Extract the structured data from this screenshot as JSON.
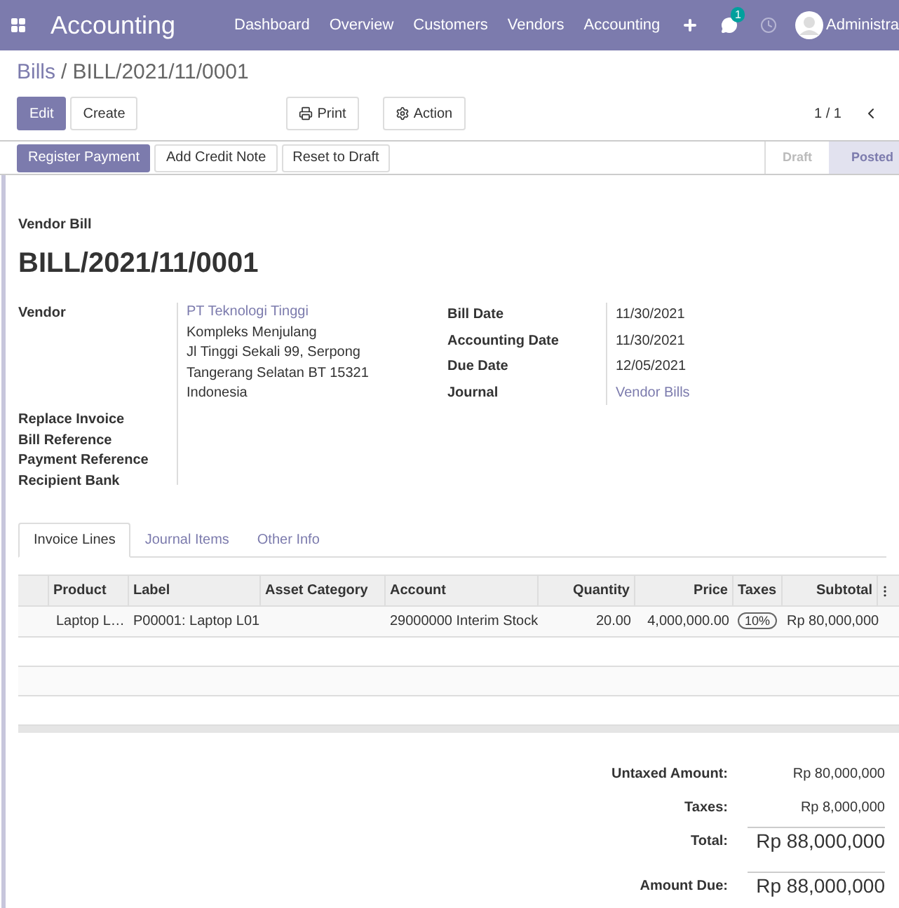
{
  "navbar": {
    "app_title": "Accounting",
    "menu": [
      "Dashboard",
      "Overview",
      "Customers",
      "Vendors",
      "Accounting"
    ],
    "chat_count": "1",
    "user": "Administra"
  },
  "breadcrumb": {
    "items": [
      "Bills",
      "BILL/2021/11/0001"
    ],
    "separator": "/"
  },
  "main_buttons": [
    {
      "label": "Edit",
      "kind": "primary"
    },
    {
      "label": "Create",
      "kind": "secondary"
    }
  ],
  "print_label": "Print",
  "action_label": "Action",
  "pager": "1 / 1",
  "status_buttons": [
    {
      "label": "Register Payment",
      "kind": "primary"
    },
    {
      "label": "Add Credit Note",
      "kind": "secondary"
    },
    {
      "label": "Reset to Draft",
      "kind": "secondary"
    }
  ],
  "stages": [
    {
      "label": "Draft",
      "selected": false
    },
    {
      "label": "Posted",
      "selected": true
    }
  ],
  "form": {
    "type_label": "Vendor Bill",
    "number": "BILL/2021/11/0001",
    "vendor": {
      "label": "Vendor",
      "name": "PT Teknologi Tinggi",
      "address": [
        "Kompleks Menjulang",
        "Jl Tinggi Sekali 99, Serpong",
        "Tangerang Selatan BT 15321",
        "Indonesia"
      ]
    },
    "extra_labels": [
      "Replace Invoice",
      "Bill Reference",
      "Payment Reference",
      "Recipient Bank"
    ],
    "right_fields": [
      {
        "label": "Bill Date",
        "value": "11/30/2021",
        "link": false
      },
      {
        "label": "Accounting Date",
        "value": "11/30/2021",
        "link": false
      },
      {
        "label": "Due Date",
        "value": "12/05/2021",
        "link": false
      },
      {
        "label": "Journal",
        "value": "Vendor Bills",
        "link": true
      }
    ]
  },
  "tabs": [
    {
      "label": "Invoice Lines",
      "selected": true
    },
    {
      "label": "Journal Items",
      "selected": false
    },
    {
      "label": "Other Info",
      "selected": false
    }
  ],
  "table": {
    "columns": [
      "Product",
      "Label",
      "Asset Category",
      "Account",
      "Quantity",
      "Price",
      "Taxes",
      "Subtotal"
    ],
    "rows": [
      {
        "product": "Laptop L…",
        "label": "P00001: Laptop L01",
        "account": "29000000 Interim Stock",
        "quantity": "20.00",
        "price": "4,000,000.00",
        "tax": "10%",
        "subtotal": "Rp 80,000,000"
      }
    ]
  },
  "totals": [
    {
      "label": "Untaxed Amount:",
      "value": "Rp 80,000,000",
      "kind": "normal"
    },
    {
      "label": "Taxes:",
      "value": "Rp 8,000,000",
      "kind": "normal"
    },
    {
      "label": "Total:",
      "value": "Rp 88,000,000",
      "kind": "total"
    },
    {
      "label": "Amount Due:",
      "value": "Rp 88,000,000",
      "kind": "due"
    }
  ]
}
